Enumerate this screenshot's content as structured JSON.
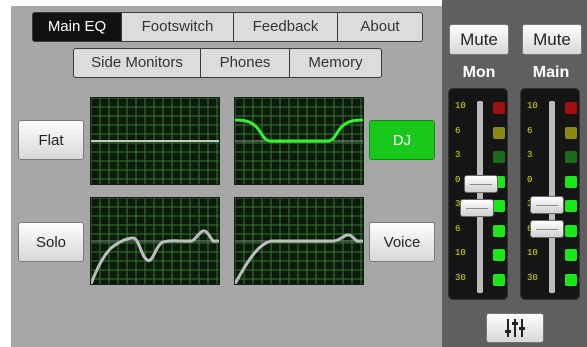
{
  "main_tabs": [
    {
      "label": "Main EQ",
      "active": true
    },
    {
      "label": "Footswitch",
      "active": false
    },
    {
      "label": "Feedback",
      "active": false
    },
    {
      "label": "About",
      "active": false
    }
  ],
  "sub_tabs": [
    {
      "label": "Side Monitors"
    },
    {
      "label": "Phones"
    },
    {
      "label": "Memory"
    }
  ],
  "presets": {
    "flat": "Flat",
    "dj": "DJ",
    "solo": "Solo",
    "voice": "Voice",
    "active": "DJ"
  },
  "channels": {
    "mon": {
      "mute_label": "Mute",
      "name": "Mon",
      "fader_level_db": 0
    },
    "main": {
      "mute_label": "Mute",
      "name": "Main",
      "fader_level_db": 3
    }
  },
  "meter_scale": [
    "10",
    "6",
    "3",
    "0",
    "3",
    "6",
    "10",
    "30"
  ],
  "meter_led_colors": [
    "red",
    "olive",
    "dark-green",
    "green",
    "green",
    "green",
    "green",
    "green"
  ],
  "colors": {
    "accent": "#18c81b",
    "graph_bg": "#0c1a0c",
    "grid": "#2f7a2f",
    "active_curve": "#34f034",
    "curve": "#bdbdbd",
    "meter_text": "#e0e000"
  },
  "icons": {
    "eq_settings": "sliders-icon"
  }
}
